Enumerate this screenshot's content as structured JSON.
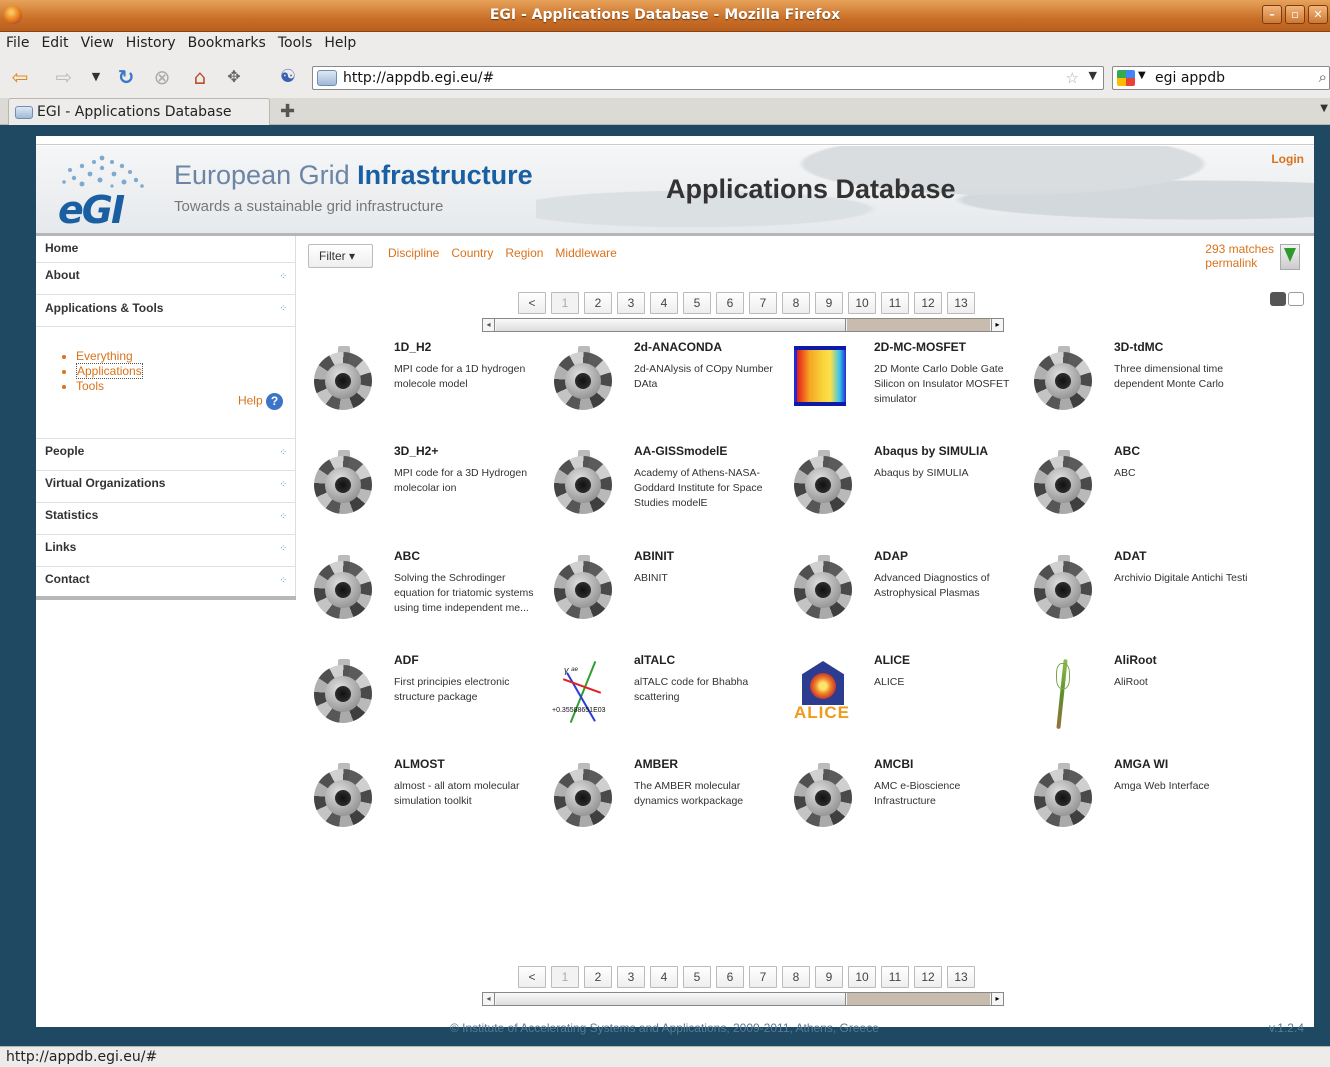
{
  "window": {
    "title": "EGI - Applications Database - Mozilla Firefox",
    "controls": [
      "–",
      "▫",
      "✕"
    ]
  },
  "menu": [
    "File",
    "Edit",
    "View",
    "History",
    "Bookmarks",
    "Tools",
    "Help"
  ],
  "nav": {
    "url": "http://appdb.egi.eu/#",
    "search": "egi appdb"
  },
  "tabs": [
    {
      "label": "EGI - Applications Database"
    }
  ],
  "header": {
    "brand_main": "European Grid ",
    "brand_bold": "Infrastructure",
    "tagline": "Towards a sustainable grid infrastructure",
    "logo_text": "eGI",
    "title": "Applications Database",
    "login": "Login"
  },
  "sidebar": {
    "home": "Home",
    "about": "About",
    "apps_tools": "Applications & Tools",
    "sub": [
      "Everything",
      "Applications",
      "Tools"
    ],
    "help": "Help",
    "people": "People",
    "vos": "Virtual Organizations",
    "statistics": "Statistics",
    "links": "Links",
    "contact": "Contact"
  },
  "filter": {
    "button": "Filter ▾",
    "links": [
      "Discipline",
      "Country",
      "Region",
      "Middleware"
    ],
    "matches": "293 matches",
    "permalink": "permalink"
  },
  "pager": {
    "prev": "<",
    "pages": [
      "1",
      "2",
      "3",
      "4",
      "5",
      "6",
      "7",
      "8",
      "9",
      "10",
      "11",
      "12",
      "13"
    ],
    "current": "1"
  },
  "apps": [
    {
      "name": "1D_H2",
      "desc": "MPI code for a 1D hydrogen molecole model",
      "icon": "gear"
    },
    {
      "name": "2d-ANACONDA",
      "desc": "2d-ANAlysis of COpy Number DAta",
      "icon": "gear"
    },
    {
      "name": "2D-MC-MOSFET",
      "desc": "2D Monte Carlo Doble Gate Silicon on Insulator MOSFET simulator",
      "icon": "mosfet"
    },
    {
      "name": "3D-tdMC",
      "desc": "Three dimensional time dependent Monte Carlo",
      "icon": "gear"
    },
    {
      "name": "3D_H2+",
      "desc": "MPI code for a 3D Hydrogen molecolar ion",
      "icon": "gear"
    },
    {
      "name": "AA-GISSmodelE",
      "desc": "Academy of Athens-NASA-Goddard Institute for Space Studies modelE",
      "icon": "gear"
    },
    {
      "name": "Abaqus by SIMULIA",
      "desc": "Abaqus by SIMULIA",
      "icon": "gear"
    },
    {
      "name": "ABC",
      "desc": "ABC",
      "icon": "gear"
    },
    {
      "name": "ABC",
      "desc": "Solving the Schrodinger equation for triatomic systems using time independent me...",
      "icon": "gear"
    },
    {
      "name": "ABINIT",
      "desc": "ABINIT",
      "icon": "gear"
    },
    {
      "name": "ADAP",
      "desc": "Advanced Diagnostics of Astrophysical Plasmas",
      "icon": "gear"
    },
    {
      "name": "ADAT",
      "desc": "Archivio Digitale Antichi Testi",
      "icon": "gear"
    },
    {
      "name": "ADF",
      "desc": "First principies electronic structure package",
      "icon": "gear"
    },
    {
      "name": "alTALC",
      "desc": "alTALC code for Bhabha scattering",
      "icon": "altalc"
    },
    {
      "name": "ALICE",
      "desc": "ALICE",
      "icon": "alice"
    },
    {
      "name": "AliRoot",
      "desc": "AliRoot",
      "icon": "aliroot"
    },
    {
      "name": "ALMOST",
      "desc": "almost - all atom molecular simulation toolkit",
      "icon": "gear"
    },
    {
      "name": "AMBER",
      "desc": "The AMBER molecular dynamics workpackage",
      "icon": "gear"
    },
    {
      "name": "AMCBI",
      "desc": "AMC e-Bioscience Infrastructure",
      "icon": "gear"
    },
    {
      "name": "AMGA WI",
      "desc": "Amga Web Interface",
      "icon": "gear"
    }
  ],
  "altalc_label": "+0.35588651E03",
  "alice_label": "ALICE",
  "footer": {
    "copyright": "© Institute of Accelerating Systems and Applications, 2009-2011, Athens, Greece",
    "version": "v.1.2.4"
  },
  "status": "http://appdb.egi.eu/#"
}
